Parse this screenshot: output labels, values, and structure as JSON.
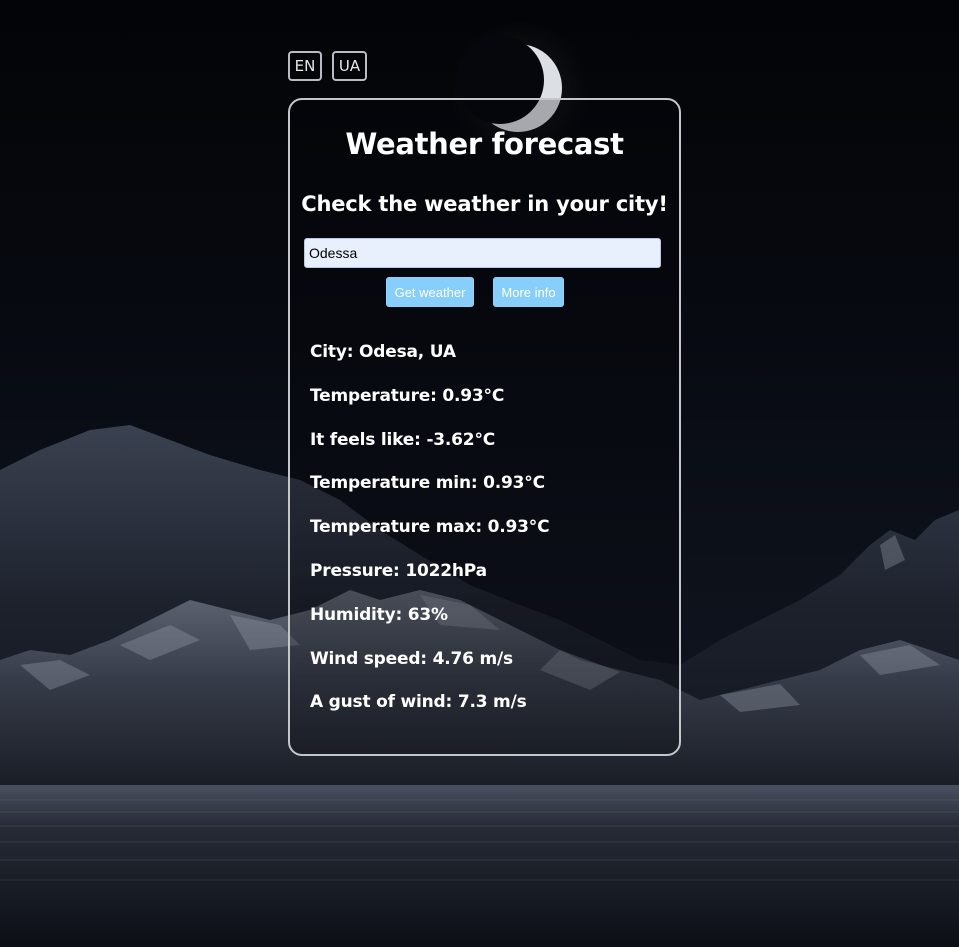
{
  "language_switch": {
    "en_label": "EN",
    "ua_label": "UA"
  },
  "card": {
    "title": "Weather forecast",
    "subtitle": "Check the weather in your city!",
    "search": {
      "value": "Odessa",
      "placeholder": ""
    },
    "buttons": {
      "get_weather": "Get weather",
      "more_info": "More info"
    },
    "weather": {
      "city": "City: Odesa, UA",
      "temperature": "Temperature: 0.93°C",
      "feels_like": "It feels like: -3.62°C",
      "temp_min": "Temperature min: 0.93°C",
      "temp_max": "Temperature max: 0.93°C",
      "pressure": "Pressure: 1022hPa",
      "humidity": "Humidity: 63%",
      "wind_speed": "Wind speed: 4.76 m/s",
      "wind_gust": "A gust of wind: 7.3 m/s"
    }
  },
  "colors": {
    "button_bg": "#87cefa",
    "input_bg": "#e8f0fe",
    "card_border": "#c4c6cc",
    "text": "#ffffff"
  }
}
